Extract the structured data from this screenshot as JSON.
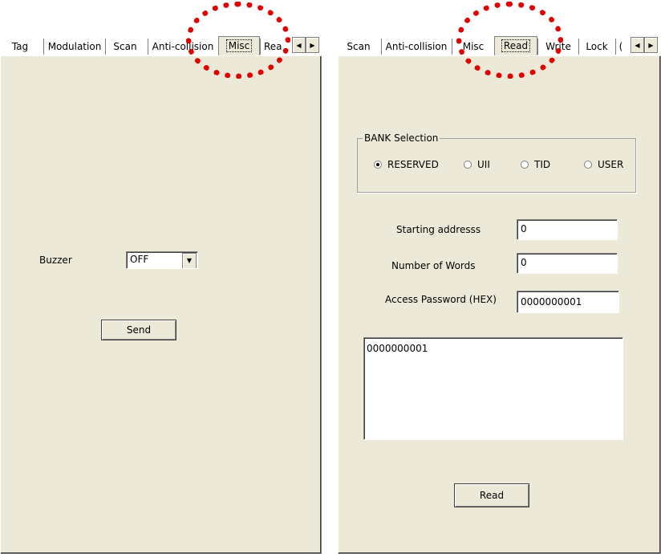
{
  "left_panel": {
    "tabs": [
      "Tag",
      "Modulation",
      "Scan",
      "Anti-collision",
      "Misc",
      "Rea"
    ],
    "selected_tab": "Misc",
    "buzzer_label": "Buzzer",
    "buzzer_value": "OFF",
    "send_label": "Send",
    "scroll_left": "◀",
    "scroll_right": "▶",
    "dropdown_arrow": "▼"
  },
  "right_panel": {
    "tabs": [
      "Scan",
      "Anti-collision",
      "Misc",
      "Read",
      "Write",
      "Lock",
      "("
    ],
    "selected_tab": "Read",
    "scroll_left": "◀",
    "scroll_right": "▶",
    "bank_selection": {
      "title": "BANK Selection",
      "options": [
        {
          "label": "RESERVED",
          "selected": true
        },
        {
          "label": "UII",
          "selected": false
        },
        {
          "label": "TID",
          "selected": false
        },
        {
          "label": "USER",
          "selected": false
        }
      ]
    },
    "starting_address_label": "Starting addresss",
    "starting_address_value": "0",
    "number_of_words_label": "Number of Words",
    "number_of_words_value": "0",
    "access_password_label": "Access Password (HEX)",
    "access_password_value": "0000000001",
    "output_text": "0000000001",
    "read_label": "Read"
  },
  "colors": {
    "highlight": "#e10000",
    "panel_bg": "#ece9d8"
  }
}
